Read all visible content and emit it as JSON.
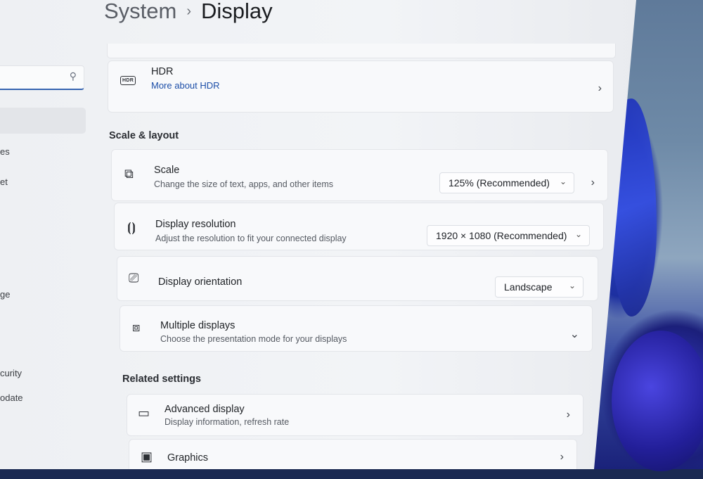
{
  "breadcrumb": {
    "parent": "System",
    "separator": "›",
    "current": "Display"
  },
  "sidebar": {
    "search_icon": "search-icon",
    "partial_items": [
      "es",
      "et",
      "ge",
      "curity",
      "odate"
    ]
  },
  "hdr": {
    "label": "HDR",
    "link": "More about HDR",
    "icon": "hdr-icon",
    "icon_text": "HDR"
  },
  "scale_layout": {
    "heading": "Scale & layout",
    "scale": {
      "label": "Scale",
      "desc": "Change the size of text, apps, and other items",
      "value": "125% (Recommended)",
      "icon": "scale-icon"
    },
    "resolution": {
      "label": "Display resolution",
      "desc": "Adjust the resolution to fit your connected display",
      "value": "1920 × 1080 (Recommended)",
      "icon": "resolution-icon"
    },
    "orientation": {
      "label": "Display orientation",
      "value": "Landscape",
      "icon": "orientation-icon"
    },
    "multiple": {
      "label": "Multiple displays",
      "desc": "Choose the presentation mode for your displays",
      "icon": "multiple-displays-icon"
    }
  },
  "related": {
    "heading": "Related settings",
    "advanced": {
      "label": "Advanced display",
      "desc": "Display information, refresh rate",
      "icon": "monitor-icon"
    },
    "graphics": {
      "label": "Graphics",
      "icon": "graphics-card-icon"
    }
  },
  "colors": {
    "accent": "#1d4fa8",
    "window_bg": "#f2f4f7"
  }
}
